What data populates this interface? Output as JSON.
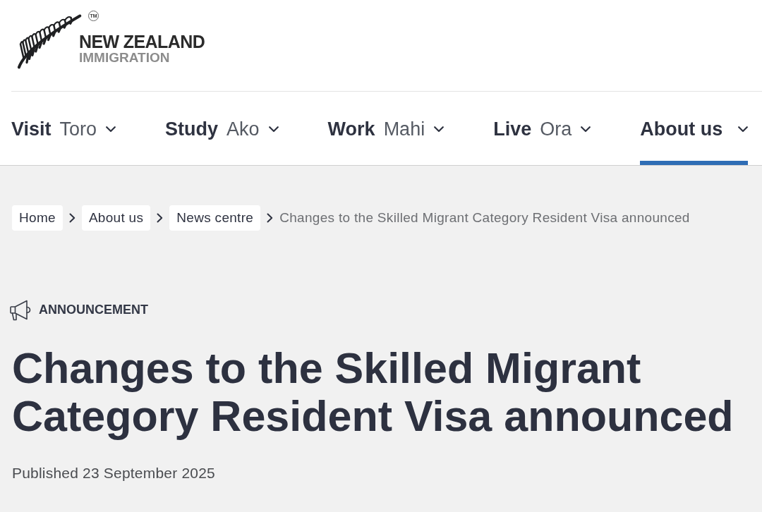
{
  "logo": {
    "trademark": "TM",
    "name": "NEW ZEALAND",
    "subtitle": "IMMIGRATION"
  },
  "nav": {
    "items": [
      {
        "label": "Visit",
        "translation": "Toro",
        "selected": false
      },
      {
        "label": "Study",
        "translation": "Ako",
        "selected": false
      },
      {
        "label": "Work",
        "translation": "Mahi",
        "selected": false
      },
      {
        "label": "Live",
        "translation": "Ora",
        "selected": false
      },
      {
        "label": "About us",
        "selected": true
      }
    ]
  },
  "breadcrumbs": [
    {
      "label": "Home",
      "kind": "link"
    },
    {
      "label": "About us",
      "kind": "link"
    },
    {
      "label": "News centre",
      "kind": "link"
    },
    {
      "label": "Changes to the Skilled Migrant Category Resident Visa announced",
      "kind": "current"
    }
  ],
  "article": {
    "category": "ANNOUNCEMENT",
    "title": "Changes to the Skilled Migrant Category Resident Visa announced",
    "published": "Published 23 September 2025"
  }
}
